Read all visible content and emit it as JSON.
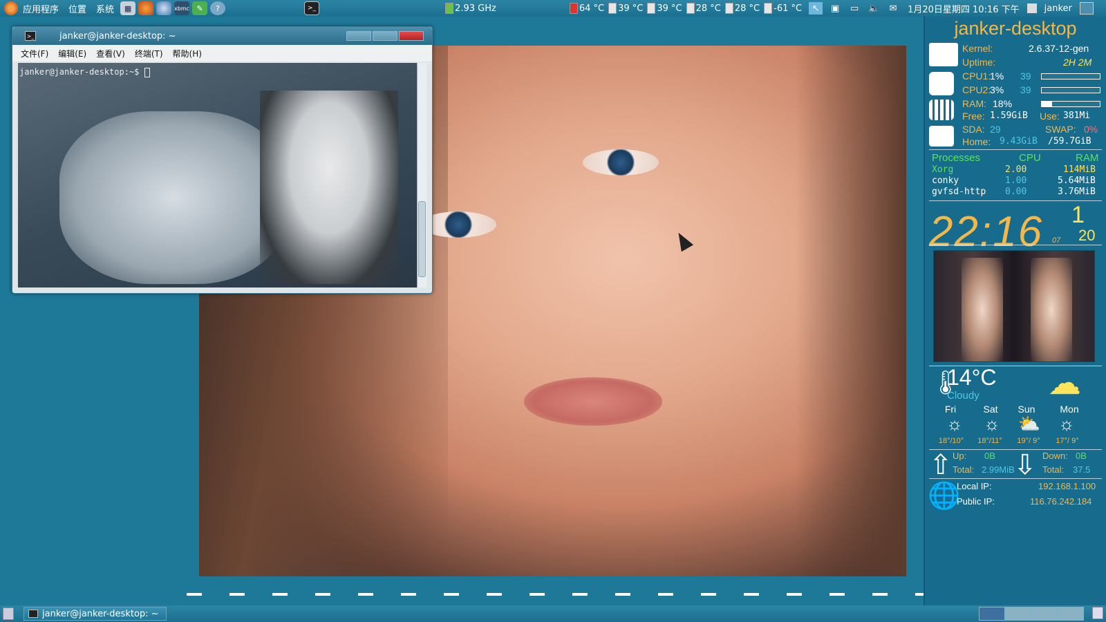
{
  "top_panel": {
    "menus": [
      "应用程序",
      "位置",
      "系统"
    ],
    "cpu_freq": "2.93 GHz",
    "temps": [
      "64 °C",
      "39 °C",
      "39 °C",
      "28 °C",
      "28 °C",
      "-61 °C"
    ],
    "datetime": "1月20日星期四 10:16 下午",
    "user": "janker"
  },
  "terminal": {
    "title": "janker@janker-desktop: ~",
    "menu": [
      "文件(F)",
      "编辑(E)",
      "查看(V)",
      "终端(T)",
      "帮助(H)"
    ],
    "prompt": "janker@janker-desktop:~$"
  },
  "conky": {
    "hostname": "janker-desktop",
    "kernel_label": "Kernel:",
    "kernel": "2.6.37-12-gen",
    "uptime_label": "Uptime:",
    "uptime": "2H 2M",
    "cpu1_label": "CPU1:",
    "cpu1": "1%",
    "cpu1_val": "39",
    "cpu2_label": "CPU2:",
    "cpu2": "3%",
    "cpu2_val": "39",
    "ram_label": "RAM:",
    "ram": "18%",
    "free_label": "Free:",
    "free": "1.59GiB",
    "use_label": "Use:",
    "use": "381Mi",
    "sda_label": "SDA:",
    "sda": "29",
    "swap_label": "SWAP:",
    "swap": "0%",
    "home_label": "Home:",
    "home_used": "9.43GiB",
    "home_total": "/59.7GiB",
    "proc_header": "Processes",
    "cpu_header": "CPU",
    "ram_header": "RAM",
    "processes": [
      {
        "name": "Xorg",
        "cpu": "2.00",
        "ram": "114MiB"
      },
      {
        "name": "conky",
        "cpu": "1.00",
        "ram": "5.64MiB"
      },
      {
        "name": "gvfsd-http",
        "cpu": "0.00",
        "ram": "3.76MiB"
      }
    ],
    "clock": "22:16",
    "clock_sec": "07",
    "month": "1",
    "day": "20",
    "temp": "14°C",
    "condition": "Cloudy",
    "forecast": [
      {
        "day": "Fri",
        "temp": "18°/10°"
      },
      {
        "day": "Sat",
        "temp": "18°/11°"
      },
      {
        "day": "Sun",
        "temp": "19°/ 9°"
      },
      {
        "day": "Mon",
        "temp": "17°/ 9°"
      }
    ],
    "up_label": "Up:",
    "up": "0B",
    "down_label": "Down:",
    "down": "0B",
    "up_total_label": "Total:",
    "up_total": "2.99MiB",
    "down_total_label": "Total:",
    "down_total": "37.5",
    "local_ip_label": "Local IP:",
    "local_ip": "192.168.1.100",
    "public_ip_label": "Public IP:",
    "public_ip": "116.76.242.184"
  },
  "bottom_panel": {
    "task": "janker@janker-desktop: ~"
  }
}
